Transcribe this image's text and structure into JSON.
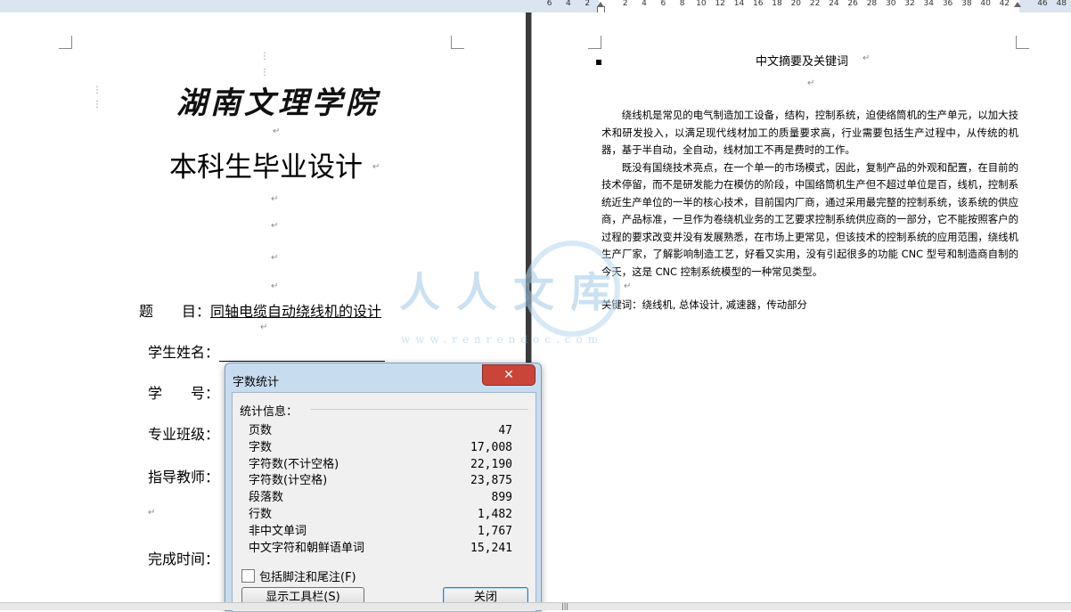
{
  "ruler": {
    "numbers": [
      "6",
      "4",
      "2",
      "",
      "2",
      "4",
      "6",
      "8",
      "10",
      "12",
      "14",
      "16",
      "18",
      "20",
      "22",
      "24",
      "26",
      "28",
      "30",
      "32",
      "34",
      "36",
      "38",
      "40",
      "42",
      "",
      "46",
      "48"
    ]
  },
  "left_page": {
    "school_name": "湖南文理学院",
    "doc_title": "本科生毕业设计",
    "fields": {
      "topic_label": "题　　目：",
      "topic_value": "同轴电缆自动绕线机的设计",
      "student_label": "学生姓名：",
      "id_label": "学　　号：",
      "class_label": "专业班级：",
      "advisor_label": "指导教师：",
      "date_label": "完成时间："
    },
    "para_mark": "↵"
  },
  "right_page": {
    "heading": "中文摘要及关键词",
    "paragraph1": "绕线机是常见的电气制造加工设备，结构，控制系统，迫使络筒机的生产单元，以加大技术和研发投入，以满足现代线材加工的质量要求高，行业需要包括生产过程中，从传统的机器，基于半自动，全自动，线材加工不再是费时的工作。",
    "paragraph2": "既没有国绕技术亮点，在一个单一的市场模式，因此，复制产品的外观和配置，在目前的技术停留，而不是研发能力在模仿的阶段，中国络筒机生产但不超过单位是百，线机，控制系统近生产单位的一半的核心技术，目前国内厂商，通过采用最完整的控制系统，该系统的供应商，产品标准，一旦作为卷绕机业务的工艺要求控制系统供应商的一部分，它不能按照客户的过程的要求改变并没有发展熟悉，在市场上更常见，但该技术的控制系统的应用范围，绕线机生产厂家，了解影响制造工艺，好看又实用，没有引起很多的功能 CNC 型号和制造商自制的今天，这是 CNC 控制系统模型的一种常见类型。",
    "keywords": "关键词：绕线机, 总体设计, 减速器，传动部分"
  },
  "watermark": {
    "text": "人人文库",
    "url": "www.renrendoc.com"
  },
  "dialog": {
    "title": "字数统计",
    "close_symbol": "✕",
    "stats_label": "统计信息：",
    "stats": [
      {
        "label": "页数",
        "value": "47"
      },
      {
        "label": "字数",
        "value": "17,008"
      },
      {
        "label": "字符数(不计空格)",
        "value": "22,190"
      },
      {
        "label": "字符数(计空格)",
        "value": "23,875"
      },
      {
        "label": "段落数",
        "value": "899"
      },
      {
        "label": "行数",
        "value": "1,482"
      },
      {
        "label": "非中文单词",
        "value": "1,767"
      },
      {
        "label": "中文字符和朝鲜语单词",
        "value": "15,241"
      }
    ],
    "include_footnotes": "包括脚注和尾注(F)",
    "show_toolbar_button": "显示工具栏(S)",
    "close_button": "关闭"
  }
}
